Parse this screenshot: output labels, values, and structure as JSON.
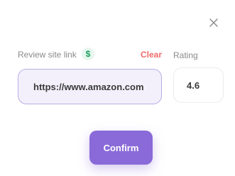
{
  "dialog": {
    "close_icon": "close-icon"
  },
  "review_link": {
    "label": "Review site link",
    "badge_icon": "dollar-icon",
    "badge_text": "$",
    "clear_label": "Clear",
    "value": "https://www.amazon.com"
  },
  "rating": {
    "label": "Rating",
    "value": "4.6"
  },
  "actions": {
    "confirm_label": "Confirm"
  },
  "colors": {
    "accent": "#8a6ad8",
    "clear": "#ef6b6b",
    "badge": "#1fa061"
  }
}
